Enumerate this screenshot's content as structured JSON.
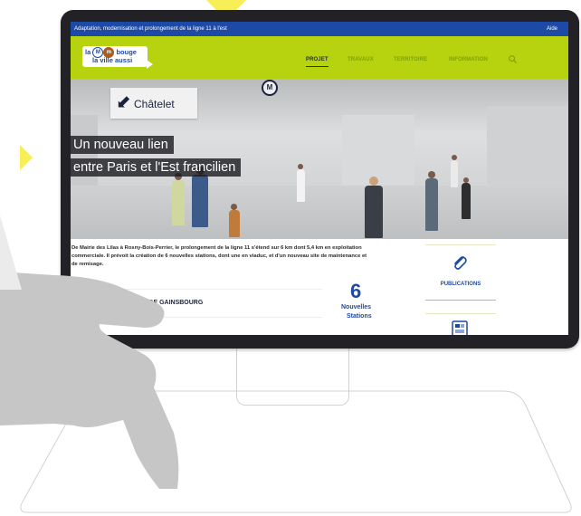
{
  "site": {
    "topbar": {
      "title": "Adaptation, modernisation et prolongement de la ligne 11 à l'est",
      "help": "Aide"
    },
    "logo": {
      "line1_prefix": "la",
      "badge1": "M",
      "badge2": "m",
      "line1_suffix": "bouge",
      "line2": "la ville aussi"
    },
    "nav": {
      "items": [
        "PROJET",
        "TRAVAUX",
        "TERRITOIRE",
        "INFORMATION"
      ],
      "active": "PROJET",
      "search_icon": "search-icon"
    },
    "hero": {
      "sign_text": "Châtelet",
      "metro_badge": "M",
      "caption_line1": "Un nouveau lien",
      "caption_line2": "entre Paris et l'Est francilien"
    },
    "intro": "De Mairie des Lilas à Rosny-Bois-Perrier, le prolongement de la ligne 11 s'étend sur 6 km dont 5,4 km en exploitation commerciale. Il prévoit la création de 6 nouvelles stations, dont une en viaduc, et d'un nouveau site de maintenance et de remisage.",
    "station_row": {
      "label": "STATION SERGE GAINSBOURG",
      "icon": "chevron-down-icon"
    },
    "stat": {
      "number": "6",
      "line1": "Nouvelles",
      "line2": "Stations"
    },
    "sidebar": {
      "publications": {
        "label": "PUBLICATIONS",
        "icon": "paperclip-icon"
      },
      "second_icon": "document-icon"
    }
  },
  "colors": {
    "topbar": "#1d4aa6",
    "navbar": "#b7d20e",
    "brand_blue": "#1d4aa6",
    "monitor_frame": "#222226",
    "accent_yellow": "#f7ef55"
  }
}
